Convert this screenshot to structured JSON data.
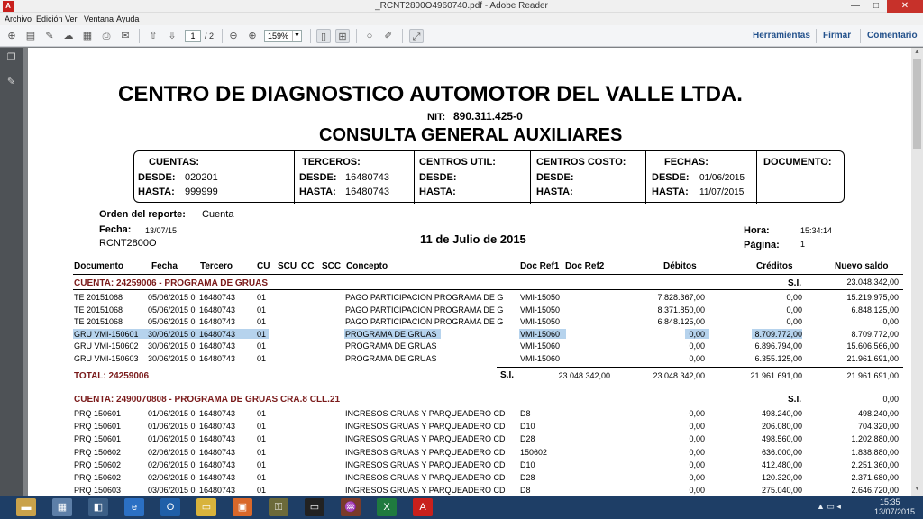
{
  "window": {
    "title": "_RCNT2800O4960740.pdf - Adobe Reader",
    "minimize": "—",
    "maximize": "□",
    "close": "✕"
  },
  "menu": [
    "Archivo",
    "Edición",
    "Ver",
    "Ventana",
    "Ayuda"
  ],
  "toolbar": {
    "page_current": "1",
    "page_total": "/ 2",
    "zoom": "159%",
    "links": [
      "Herramientas",
      "Firmar",
      "Comentario"
    ]
  },
  "report": {
    "company": "CENTRO DE DIAGNOSTICO AUTOMOTOR DEL VALLE LTDA.",
    "nit_label": "NIT:",
    "nit": "890.311.425-0",
    "subtitle": "CONSULTA GENERAL AUXILIARES",
    "box": {
      "cuentas": {
        "title": "CUENTAS:",
        "desde_label": "DESDE:",
        "desde": "020201",
        "hasta_label": "HASTA:",
        "hasta": "999999"
      },
      "terceros": {
        "title": "TERCEROS:",
        "desde_label": "DESDE:",
        "desde": "16480743",
        "hasta_label": "HASTA:",
        "hasta": "16480743"
      },
      "centros_util": {
        "title": "CENTROS UTIL:",
        "desde_label": "DESDE:",
        "hasta_label": "HASTA:"
      },
      "centros_costo": {
        "title": "CENTROS COSTO:",
        "desde_label": "DESDE:",
        "hasta_label": "HASTA:"
      },
      "fechas": {
        "title": "FECHAS:",
        "desde_label": "DESDE:",
        "desde": "01/06/2015",
        "hasta_label": "HASTA:",
        "hasta": "11/07/2015"
      },
      "documento": {
        "title": "DOCUMENTO:"
      }
    },
    "orden_label": "Orden del reporte:",
    "orden": "Cuenta",
    "fecha_label": "Fecha:",
    "fecha": "13/07/15",
    "code": "RCNT2800O",
    "date_long": "11 de Julio de 2015",
    "hora_label": "Hora:",
    "hora": "15:34:14",
    "pagina_label": "Página:",
    "pagina": "1",
    "columns": [
      "Documento",
      "Fecha",
      "Tercero",
      "CU",
      "SCU",
      "CC",
      "SCC",
      "Concepto",
      "Doc Ref1",
      "Doc Ref2",
      "Débitos",
      "Créditos",
      "Nuevo saldo"
    ],
    "account1": {
      "title": "CUENTA: 24259006 - PROGRAMA DE GRUAS",
      "si_label": "S.I.",
      "si_value": "23.048.342,00",
      "rows": [
        {
          "doc": "TE   20151068",
          "fecha": "05/06/2015 0",
          "tercero": "16480743",
          "cu": "01",
          "concepto": "PAGO PARTICIPACION PROGRAMA DE G",
          "ref1": "VMI-15050",
          "deb": "7.828.367,00",
          "cred": "0,00",
          "saldo": "15.219.975,00"
        },
        {
          "doc": "TE   20151068",
          "fecha": "05/06/2015 0",
          "tercero": "16480743",
          "cu": "01",
          "concepto": "PAGO PARTICIPACION PROGRAMA DE G",
          "ref1": "VMI-15050",
          "deb": "8.371.850,00",
          "cred": "0,00",
          "saldo": "6.848.125,00"
        },
        {
          "doc": "TE   20151068",
          "fecha": "05/06/2015 0",
          "tercero": "16480743",
          "cu": "01",
          "concepto": "PAGO PARTICIPACION PROGRAMA DE G",
          "ref1": "VMI-15050",
          "deb": "6.848.125,00",
          "cred": "0,00",
          "saldo": "0,00"
        },
        {
          "doc": "GRU VMI-150601",
          "fecha": "30/06/2015 0",
          "tercero": "16480743",
          "cu": "01",
          "concepto": "PROGRAMA DE GRUAS",
          "ref1": "VMI-15060",
          "deb": "0,00",
          "cred": "8.709.772,00",
          "saldo": "8.709.772,00"
        },
        {
          "doc": "GRU VMI-150602",
          "fecha": "30/06/2015 0",
          "tercero": "16480743",
          "cu": "01",
          "concepto": "PROGRAMA DE GRUAS",
          "ref1": "VMI-15060",
          "deb": "0,00",
          "cred": "6.896.794,00",
          "saldo": "15.606.566,00"
        },
        {
          "doc": "GRU VMI-150603",
          "fecha": "30/06/2015 0",
          "tercero": "16480743",
          "cu": "01",
          "concepto": "PROGRAMA DE GRUAS",
          "ref1": "VMI-15060",
          "deb": "0,00",
          "cred": "6.355.125,00",
          "saldo": "21.961.691,00"
        }
      ],
      "total_label": "TOTAL: 24259006",
      "total_si": "S.I.",
      "total_si_value": "23.048.342,00",
      "total_deb": "23.048.342,00",
      "total_cred": "21.961.691,00",
      "total_saldo": "21.961.691,00"
    },
    "account2": {
      "title": "CUENTA: 2490070808 - PROGRAMA DE GRUAS CRA.8 CLL.21",
      "si_label": "S.I.",
      "si_value": "0,00",
      "rows": [
        {
          "doc": "PRQ 150601",
          "fecha": "01/06/2015 0",
          "tercero": "16480743",
          "cu": "01",
          "concepto": "INGRESOS GRUAS Y PARQUEADERO CD",
          "ref1": "D8",
          "deb": "0,00",
          "cred": "498.240,00",
          "saldo": "498.240,00"
        },
        {
          "doc": "PRQ 150601",
          "fecha": "01/06/2015 0",
          "tercero": "16480743",
          "cu": "01",
          "concepto": "INGRESOS GRUAS Y PARQUEADERO CD",
          "ref1": "D10",
          "deb": "0,00",
          "cred": "206.080,00",
          "saldo": "704.320,00"
        },
        {
          "doc": "PRQ 150601",
          "fecha": "01/06/2015 0",
          "tercero": "16480743",
          "cu": "01",
          "concepto": "INGRESOS GRUAS Y PARQUEADERO CD",
          "ref1": "D28",
          "deb": "0,00",
          "cred": "498.560,00",
          "saldo": "1.202.880,00"
        },
        {
          "doc": "PRQ 150602",
          "fecha": "02/06/2015 0",
          "tercero": "16480743",
          "cu": "01",
          "concepto": "INGRESOS GRUAS Y PARQUEADERO CD",
          "ref1": "150602",
          "deb": "0,00",
          "cred": "636.000,00",
          "saldo": "1.838.880,00"
        },
        {
          "doc": "PRQ 150602",
          "fecha": "02/06/2015 0",
          "tercero": "16480743",
          "cu": "01",
          "concepto": "INGRESOS GRUAS Y PARQUEADERO CD",
          "ref1": "D10",
          "deb": "0,00",
          "cred": "412.480,00",
          "saldo": "2.251.360,00"
        },
        {
          "doc": "PRQ 150602",
          "fecha": "02/06/2015 0",
          "tercero": "16480743",
          "cu": "01",
          "concepto": "INGRESOS GRUAS Y PARQUEADERO CD",
          "ref1": "D28",
          "deb": "0,00",
          "cred": "120.320,00",
          "saldo": "2.371.680,00"
        },
        {
          "doc": "PRQ 150603",
          "fecha": "03/06/2015 0",
          "tercero": "16480743",
          "cu": "01",
          "concepto": "INGRESOS GRUAS Y PARQUEADERO CD",
          "ref1": "D8",
          "deb": "0,00",
          "cred": "275.040,00",
          "saldo": "2.646.720,00"
        }
      ]
    }
  },
  "taskbar": {
    "time": "15:35",
    "date": "13/07/2015"
  },
  "colors": {
    "accent_text": "#7a1a1a",
    "selection": "#b6d3ed",
    "toolbar_link": "#24528c",
    "taskbar": "#1e3e66"
  }
}
